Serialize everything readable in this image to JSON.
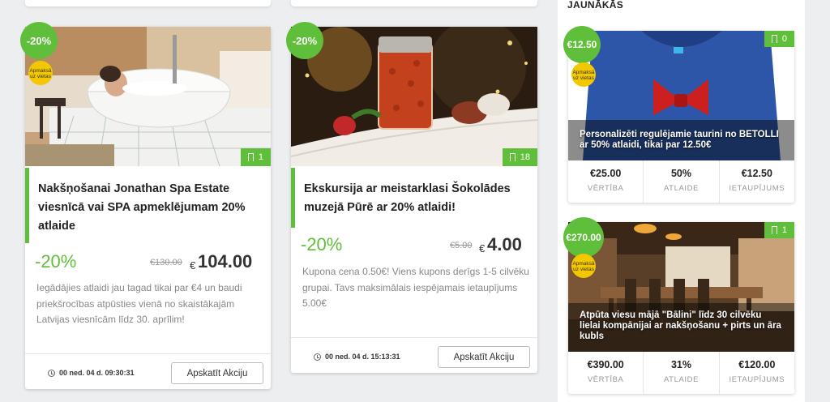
{
  "sidebar": {
    "title": "JAUNĀKĀS"
  },
  "deals": [
    {
      "discount_badge": "-20%",
      "pay_badge": "Apmaksā uz vietas",
      "count": "1",
      "title": "Nakšņošanai Jonathan Spa Estate viesnīcā vai SPA apmeklējumam 20% atlaide",
      "discount": "-20%",
      "old_price": "€130.00",
      "currency": "€",
      "price": "104.00",
      "description": "Iegādājies atlaidi jau tagad tikai par €4 un baudi priekšrocības atpūsties vienā no skaistākajām Latvijas viesnīcām līdz 30. aprīlim!",
      "timer": "00 ned. 04 d. 09:30:31",
      "button": "Apskatīt Akciju"
    },
    {
      "discount_badge": "-20%",
      "count": "18",
      "title": "Ekskursija ar meistarklasi Šokolādes muzejā Pūrē ar 20% atlaidi!",
      "discount": "-20%",
      "old_price": "€5.00",
      "currency": "€",
      "price": "4.00",
      "description": "Kupona cena 0.50€! Viens kupons derīgs 1-5 cilvēku grupai. Tavs maksimālais iespējamais ietaupījums 5.00€",
      "timer": "00 ned. 04 d. 15:13:31",
      "button": "Apskatīt Akciju"
    }
  ],
  "side_deals": [
    {
      "price_badge": "€12.50",
      "pay_badge": "Apmaksā uz vietas",
      "count": "0",
      "caption": "Personalizēti regulējamie taurini no BETOLLI ar 50% atlaidi, tikai par 12.50€",
      "stats": [
        {
          "value": "€25.00",
          "label": "VĒRTĪBA"
        },
        {
          "value": "50%",
          "label": "ATLAIDE"
        },
        {
          "value": "€12.50",
          "label": "IETAUPĪJUMS"
        }
      ]
    },
    {
      "price_badge": "€270.00",
      "pay_badge": "Apmaksā uz vietas",
      "count": "1",
      "caption": "Atpūta viesu mājā \"Bālini\" līdz 30 cilvēku lielai kompānijai ar nakšņošanu + pirts un āra kubls",
      "stats": [
        {
          "value": "€390.00",
          "label": "VĒRTĪBA"
        },
        {
          "value": "31%",
          "label": "ATLAIDE"
        },
        {
          "value": "€120.00",
          "label": "IETAUPĪJUMS"
        }
      ]
    }
  ],
  "colors": {
    "accent": "#5fbe3a",
    "badge_yellow": "#f4c800"
  }
}
